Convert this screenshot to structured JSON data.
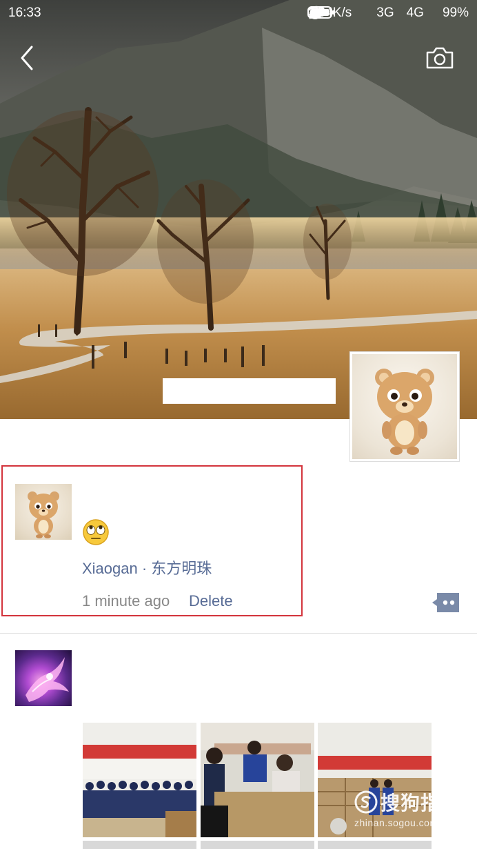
{
  "status_bar": {
    "time": "16:33",
    "speed": "2.04K/s",
    "network1": "3G",
    "network2": "4G",
    "battery": "99%"
  },
  "header": {
    "back_icon": "chevron-left-icon",
    "camera_icon": "camera-icon"
  },
  "post": {
    "emoji": "eye-roll-emoji",
    "location": "Xiaogan · 东方明珠",
    "time": "1 minute ago",
    "delete_label": "Delete",
    "comment_icon": "comment-dots-icon"
  },
  "watermark": {
    "brand": "搜狗指南",
    "site": "zhinan.sogou.com"
  },
  "colors": {
    "link": "#576b95",
    "meta": "#888888",
    "highlight": "#d3343c"
  }
}
